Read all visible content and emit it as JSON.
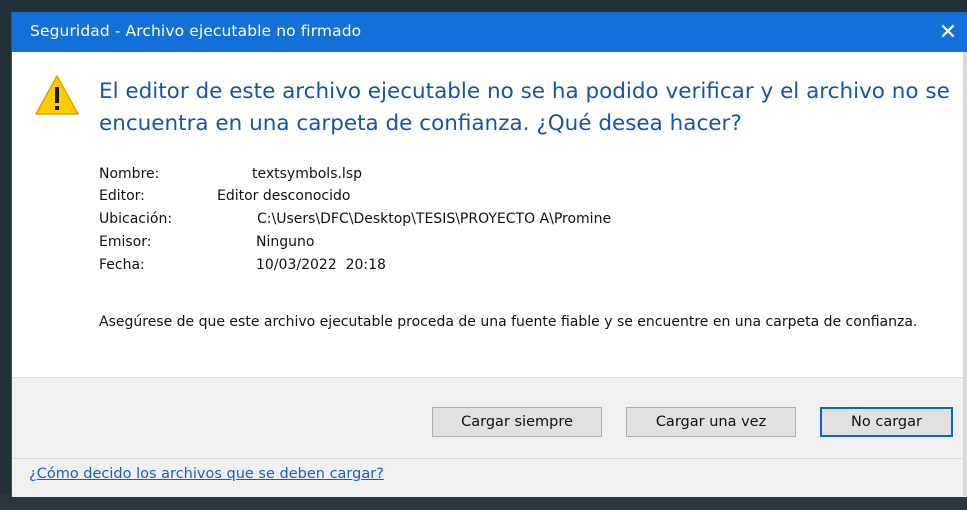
{
  "dialog": {
    "title": "Seguridad - Archivo ejecutable no firmado",
    "close_glyph": "✕",
    "icon": "warning-icon",
    "headline": "El editor de este archivo ejecutable no se ha podido verificar y el archivo no se encuentra en una carpeta de confianza. ¿Qué desea hacer?",
    "details": {
      "name_label": "Nombre:",
      "name_value": "textsymbols.lsp",
      "editor_label": "Editor:",
      "editor_value": "Editor desconocido",
      "location_label": "Ubicación:",
      "location_value": "C:\\Users\\DFC\\Desktop\\TESIS\\PROYECTO A\\Promine",
      "issuer_label": "Emisor:",
      "issuer_value": "Ninguno",
      "date_label": "Fecha:",
      "date_value": "10/03/2022  20:18"
    },
    "note": "Asegúrese de que este archivo ejecutable proceda de una fuente fiable y se encuentre en una carpeta de confianza.",
    "buttons": {
      "always_load": "Cargar siempre",
      "load_once": "Cargar una vez",
      "do_not_load": "No cargar"
    },
    "help_link": "¿Cómo decido los archivos que se deben cargar?",
    "colors": {
      "titlebar": "#1370d8",
      "headline": "#1554a8",
      "link": "#1560c0",
      "warning_fill": "#ffcc00"
    }
  }
}
